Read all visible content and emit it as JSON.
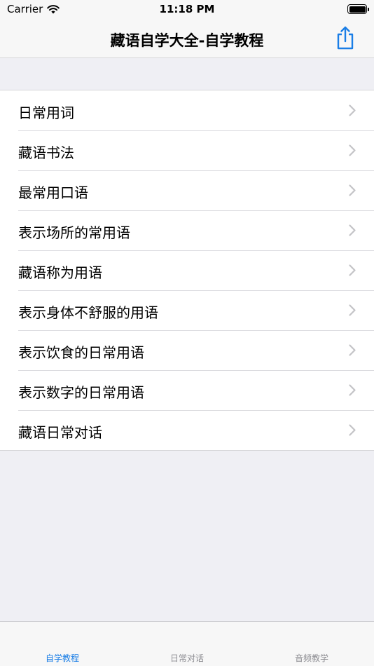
{
  "status_bar": {
    "carrier": "Carrier",
    "time": "11:18 PM"
  },
  "nav": {
    "title": "藏语自学大全-自学教程",
    "share_icon": "share-icon"
  },
  "list": {
    "items": [
      {
        "label": "日常用词"
      },
      {
        "label": "藏语书法"
      },
      {
        "label": "最常用口语"
      },
      {
        "label": "表示场所的常用语"
      },
      {
        "label": "藏语称为用语"
      },
      {
        "label": "表示身体不舒服的用语"
      },
      {
        "label": "表示饮食的日常用语"
      },
      {
        "label": "表示数字的日常用语"
      },
      {
        "label": "藏语日常对话"
      }
    ]
  },
  "tabs": [
    {
      "label": "自学教程",
      "active": true
    },
    {
      "label": "日常对话",
      "active": false
    },
    {
      "label": "音频教学",
      "active": false
    }
  ],
  "colors": {
    "accent": "#1a7ee6",
    "inactive_tab": "#8e8e93",
    "background": "#efeff4"
  }
}
